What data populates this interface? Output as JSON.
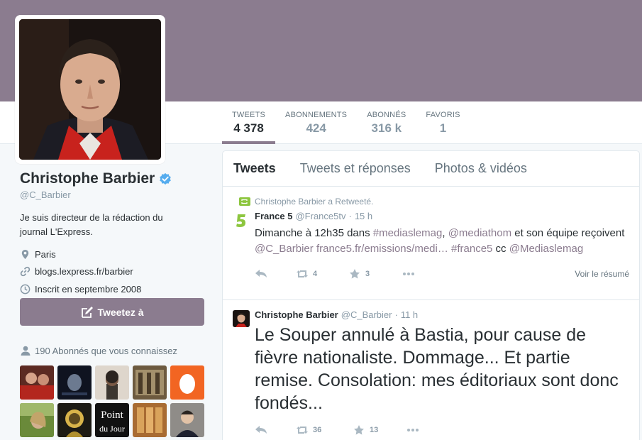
{
  "profile": {
    "name": "Christophe Barbier",
    "handle": "@C_Barbier",
    "bio": "Je suis directeur de la rédaction du journal L'Express.",
    "location": "Paris",
    "website": "blogs.lexpress.fr/barbier",
    "joined": "Inscrit en septembre 2008"
  },
  "stats": [
    {
      "label": "TWEETS",
      "value": "4 378"
    },
    {
      "label": "ABONNEMENTS",
      "value": "424"
    },
    {
      "label": "ABONNÉS",
      "value": "316 k"
    },
    {
      "label": "FAVORIS",
      "value": "1"
    }
  ],
  "tweet_button": "Tweetez à",
  "followers_known": "190 Abonnés que vous connaissez",
  "thumbs_logo_text": [
    "Point",
    "du Jour"
  ],
  "tabs": [
    "Tweets",
    "Tweets et réponses",
    "Photos & vidéos"
  ],
  "tweets": [
    {
      "retweet_label": "Christophe Barbier a Retweeté.",
      "author": "France 5",
      "handle": "@France5tv",
      "time": "15 h",
      "text_parts": [
        "Dimanche à 12h35 dans ",
        "#mediaslemag",
        ", ",
        "@mediathom",
        " et son équipe reçoivent ",
        "@C_Barbier",
        " ",
        "france5.fr/emissions/medi…",
        " ",
        "#france5",
        " cc ",
        "@Mediaslemag"
      ],
      "retweets": "4",
      "favorites": "3",
      "summary": "Voir le résumé"
    },
    {
      "author": "Christophe Barbier",
      "handle": "@C_Barbier",
      "time": "11 h",
      "text": "Le Souper annulé à Bastia, pour cause de fièvre nationaliste. Dommage... Et partie remise. Consolation: mes éditoriaux sont donc fondés...",
      "retweets": "36",
      "favorites": "13"
    }
  ],
  "colors": {
    "accent": "#8b7c8f",
    "verified": "#55acee",
    "france5": "#8dc63f"
  },
  "icons": [
    "verified-icon",
    "location-icon",
    "link-icon",
    "calendar-icon",
    "compose-icon",
    "followers-icon",
    "retweet-icon",
    "reply-icon",
    "star-icon",
    "more-icon"
  ]
}
